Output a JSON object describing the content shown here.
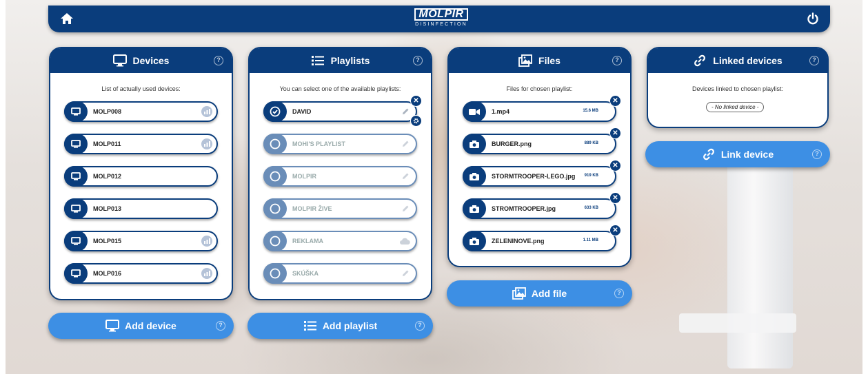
{
  "header": {
    "logo_main": "MOLPIR",
    "logo_sub": "DISINFECTION"
  },
  "devices": {
    "title": "Devices",
    "subtitle": "List of actually used devices:",
    "add_label": "Add device",
    "items": [
      {
        "name": "MOLP008"
      },
      {
        "name": "MOLP011"
      },
      {
        "name": "MOLP012"
      },
      {
        "name": "MOLP013"
      },
      {
        "name": "MOLP015"
      },
      {
        "name": "MOLP016"
      }
    ]
  },
  "playlists": {
    "title": "Playlists",
    "subtitle": "You can select one of the available playlists:",
    "add_label": "Add playlist",
    "items": [
      {
        "name": "DAVID"
      },
      {
        "name": "MOHI'S PLAYLIST"
      },
      {
        "name": "MOLPIR"
      },
      {
        "name": "MOLPIR ŽIVE"
      },
      {
        "name": "REKLAMA"
      },
      {
        "name": "SKÚŠKA"
      }
    ]
  },
  "files": {
    "title": "Files",
    "subtitle": "Files for chosen playlist:",
    "add_label": "Add file",
    "items": [
      {
        "name": "1.mp4",
        "size": "15.6 MB"
      },
      {
        "name": "BURGER.png",
        "size": "889 KB"
      },
      {
        "name": "STORMTROOPER-LEGO.jpg",
        "size": "919 KB"
      },
      {
        "name": "STROMTROOPER.jpg",
        "size": "633 KB"
      },
      {
        "name": "ZELENINOVE.png",
        "size": "1.11 MB"
      }
    ]
  },
  "linked": {
    "title": "Linked devices",
    "subtitle": "Devices linked to chosen playlist:",
    "empty_text": "- No linked device -",
    "link_label": "Link device"
  },
  "colors": {
    "primary": "#0a3d7c",
    "accent": "#3d8fe4",
    "inactive": "#6a8db8"
  }
}
